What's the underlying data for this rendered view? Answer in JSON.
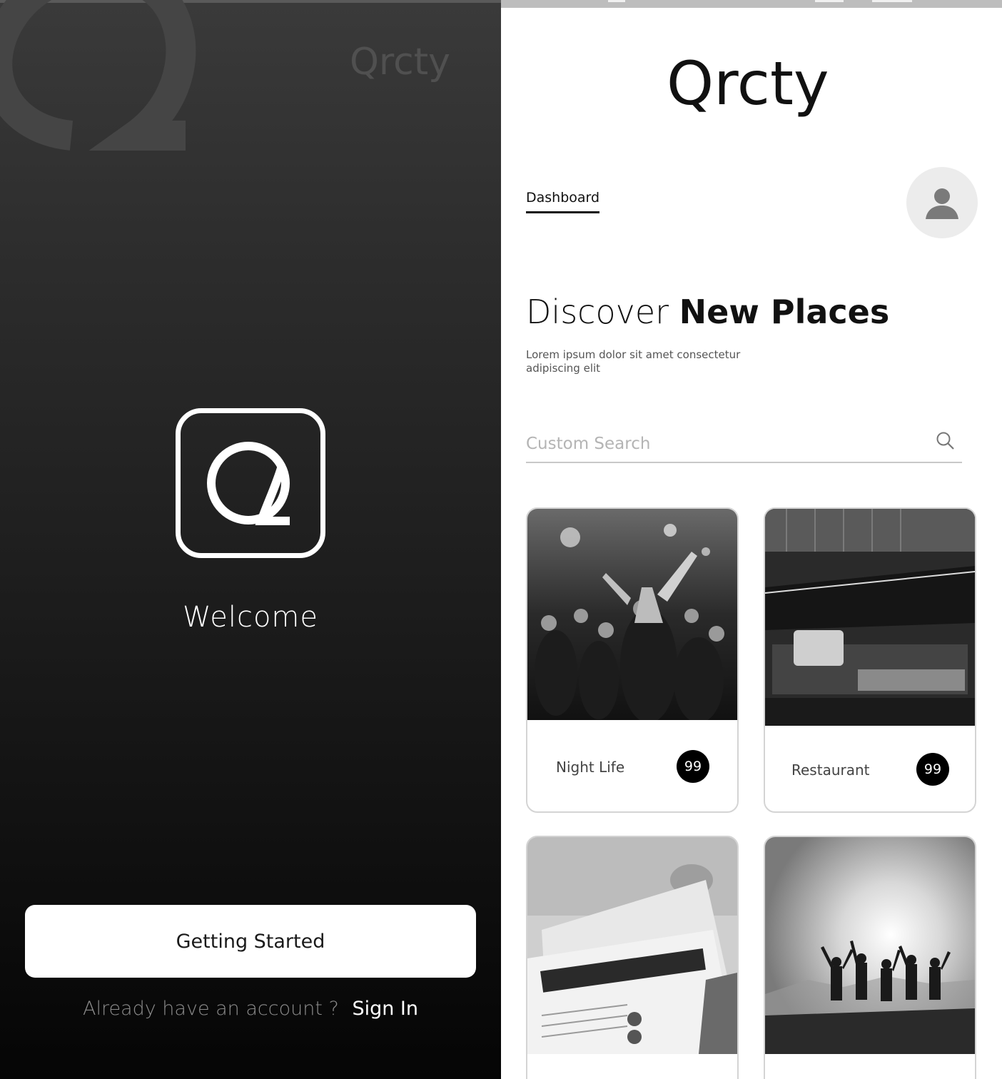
{
  "welcome_screen": {
    "ghost_brand": "Qrcty",
    "welcome_text": "Welcome",
    "primary_button": "Getting Started",
    "account_prompt": "Already have an account ?",
    "sign_in_link": "Sign In"
  },
  "dashboard_screen": {
    "brand": "Qrcty",
    "nav": {
      "active_tab": "Dashboard"
    },
    "headline_light": "Discover ",
    "headline_bold": "New Places",
    "subtitle": "Lorem ipsum dolor sit amet consectetur adipiscing elit",
    "search": {
      "placeholder": "Custom Search",
      "value": ""
    },
    "categories": [
      {
        "label": "Night Life",
        "count": "99"
      },
      {
        "label": "Restaurant",
        "count": "99"
      },
      {
        "label": "",
        "count": ""
      },
      {
        "label": "",
        "count": ""
      }
    ]
  },
  "icons": [
    "q-logo-icon",
    "user-silhouette-icon",
    "search-icon"
  ],
  "colors": {
    "dark_bg": "#1a1a1a",
    "accent": "#000000",
    "light_avatar": "#ececec",
    "divider": "#c8c8c8"
  }
}
